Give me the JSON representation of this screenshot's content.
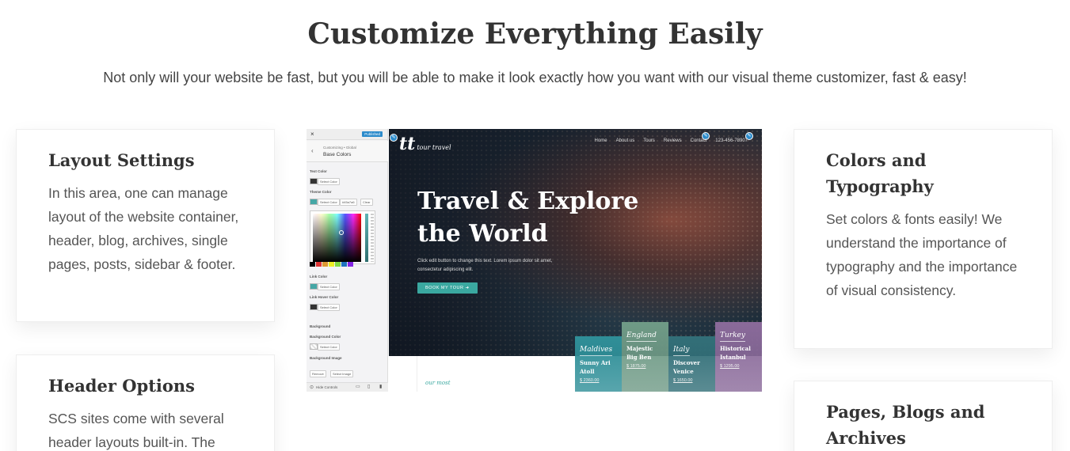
{
  "section": {
    "title": "Customize Everything Easily",
    "subtitle": "Not only will your website be fast, but you will be able to make it look exactly how you want with our visual theme customizer, fast & easy!"
  },
  "cards": {
    "layout": {
      "title": "Layout Settings",
      "text": "In this area, one can manage layout of the website container, header, blog, archives, single pages, posts, sidebar & footer."
    },
    "header": {
      "title": "Header Options",
      "text": "SCS sites come with several header layouts built-in. The"
    },
    "colors": {
      "title": "Colors and Typography",
      "text": "Set colors & fonts easily! We understand the importance of typography and the importance of visual consistency."
    },
    "pages": {
      "title": "Pages, Blogs and Archives",
      "text": ""
    }
  },
  "preview": {
    "customizer": {
      "close": "×",
      "publish": "Published",
      "back": "‹",
      "crumb_path": "Customizing • Global",
      "crumb_title": "Base Colors",
      "text_color_label": "Text Color",
      "theme_color_label": "Theme Color",
      "select_color": "Select Color",
      "hex_value": "#45a7a6",
      "clear": "Clear",
      "link_color_label": "Link Color",
      "link_hover_label": "Link Hover Color",
      "background_heading": "Background",
      "background_color_label": "Background Color",
      "background_image_label": "Background Image",
      "remove": "Remove",
      "select_image": "Select Image",
      "hide_controls": "Hide Controls",
      "accent": "#45a7a6",
      "palette": [
        "#000000",
        "#dd3333",
        "#dd9933",
        "#eeee22",
        "#81d742",
        "#1e73be",
        "#8224e3"
      ]
    },
    "site": {
      "logo": "tt",
      "logo_sub": "tour travel",
      "nav": [
        "Home",
        "About us",
        "Tours",
        "Reviews",
        "Contact",
        "123-456-78907"
      ],
      "hero_title": "Travel & Explore the World",
      "hero_text": "Click edit button to change this text. Lorem ipsum dolor sit amet, consectetur adipiscing elit.",
      "hero_button": "BOOK MY TOUR",
      "our_most": "our most",
      "tiles": [
        {
          "region": "Maldives",
          "name": "Sunny Ari Atoll",
          "price": "$ 2360.00",
          "color": "#2f8f98"
        },
        {
          "region": "England",
          "name": "Majestic Big Ben",
          "price": "$ 1875.00",
          "color": "#6f9a86"
        },
        {
          "region": "Italy",
          "name": "Discover Venice",
          "price": "$ 1650.00",
          "color": "#326f78"
        },
        {
          "region": "Turkey",
          "name": "Historical Istanbul",
          "price": "$ 1295.00",
          "color": "#8a6a9a"
        }
      ]
    }
  }
}
